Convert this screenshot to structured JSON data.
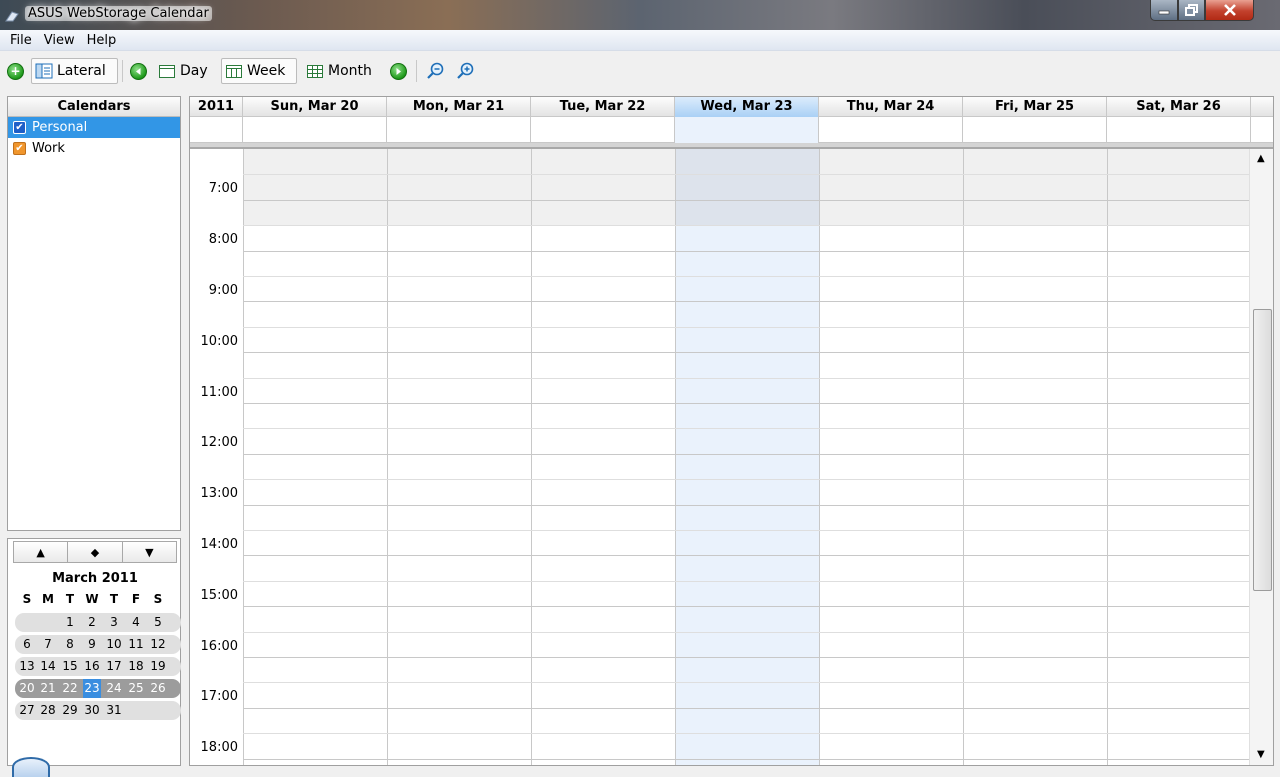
{
  "window": {
    "title": "ASUS WebStorage Calendar"
  },
  "menu": {
    "items": [
      "File",
      "View",
      "Help"
    ]
  },
  "toolbar": {
    "lateral_label": "Lateral",
    "day_label": "Day",
    "week_label": "Week",
    "month_label": "Month"
  },
  "calendars": {
    "header": "Calendars",
    "items": [
      {
        "label": "Personal",
        "color": "#1e5fc8",
        "checked": true
      },
      {
        "label": "Work",
        "color": "#f0962d",
        "checked": true
      }
    ]
  },
  "week": {
    "year": "2011",
    "days": [
      "Sun, Mar 20",
      "Mon, Mar 21",
      "Tue, Mar 22",
      "Wed, Mar 23",
      "Thu, Mar 24",
      "Fri, Mar 25",
      "Sat, Mar 26"
    ],
    "today_index": 3,
    "hours": [
      "7:00",
      "8:00",
      "9:00",
      "10:00",
      "11:00",
      "12:00",
      "13:00",
      "14:00",
      "15:00",
      "16:00",
      "17:00",
      "18:00"
    ]
  },
  "mini_calendar": {
    "month_title": "March 2011",
    "weekdays": [
      "S",
      "M",
      "T",
      "W",
      "T",
      "F",
      "S"
    ],
    "weeks": [
      [
        "",
        "",
        "1",
        "2",
        "3",
        "4",
        "5"
      ],
      [
        "6",
        "7",
        "8",
        "9",
        "10",
        "11",
        "12"
      ],
      [
        "13",
        "14",
        "15",
        "16",
        "17",
        "18",
        "19"
      ],
      [
        "20",
        "21",
        "22",
        "23",
        "24",
        "25",
        "26"
      ],
      [
        "27",
        "28",
        "29",
        "30",
        "31",
        "",
        ""
      ]
    ],
    "selected_week_index": 3,
    "today": "23"
  },
  "colors": {
    "today_highlight": "#eaf2fc",
    "selection": "#3296e6"
  }
}
